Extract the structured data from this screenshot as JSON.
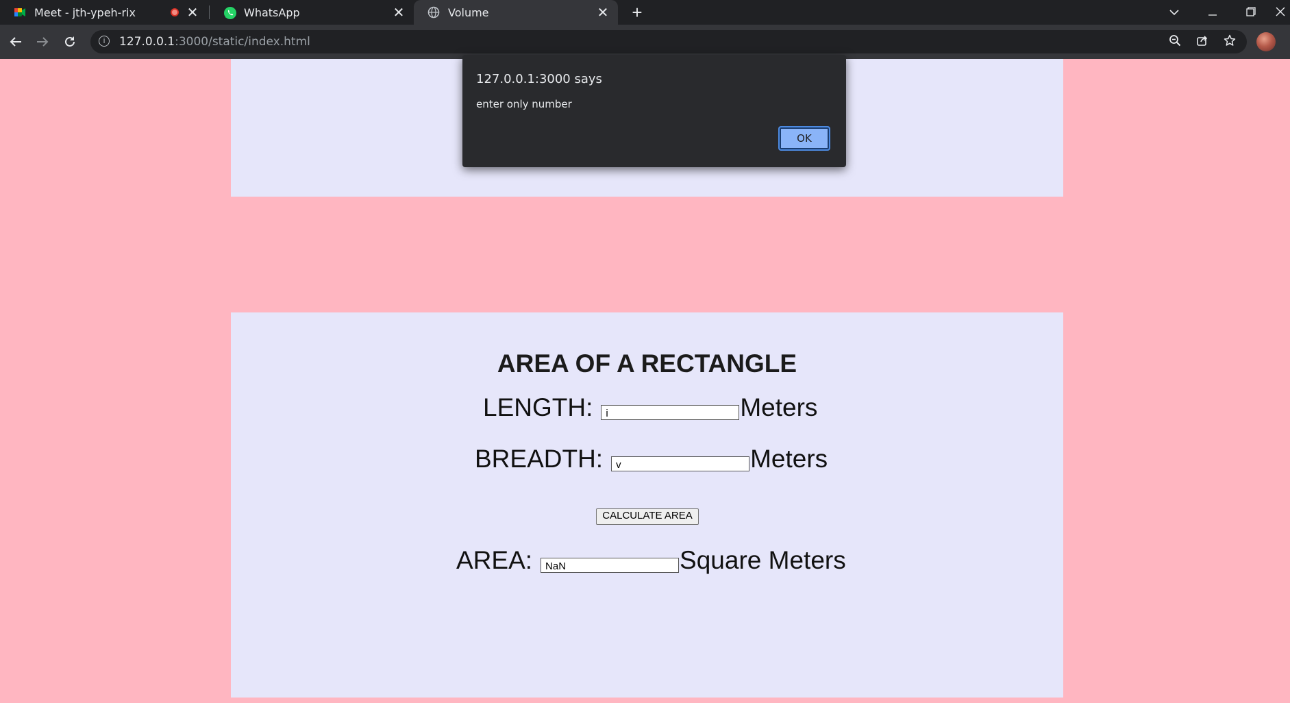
{
  "browser": {
    "tabs": [
      {
        "title": "Meet - jth-ypeh-rix",
        "icon": "google-meet-icon",
        "recording": true
      },
      {
        "title": "WhatsApp",
        "icon": "whatsapp-icon"
      },
      {
        "title": "Volume",
        "icon": "globe-icon",
        "active": true
      }
    ],
    "close_glyph": "✕",
    "new_tab_glyph": "+",
    "url_host": "127.0.0.1",
    "url_rest": ":3000/static/index.html"
  },
  "page": {
    "heading": "AREA OF A RECTANGLE",
    "length_label": "LENGTH:",
    "length_value": "i",
    "length_unit": "Meters",
    "breadth_label": "BREADTH:",
    "breadth_value": "v",
    "breadth_unit": "Meters",
    "calculate_button": "CALCULATE AREA",
    "area_label": "AREA:",
    "area_value": "NaN",
    "area_unit": "Square Meters"
  },
  "dialog": {
    "title": "127.0.0.1:3000 says",
    "message": "enter only number",
    "ok_label": "OK"
  },
  "colors": {
    "page_background": "#ffb6c1",
    "panel_background": "#e6e6fa",
    "dialog_background": "#292a2d",
    "ok_button": "#8ab4f8"
  }
}
